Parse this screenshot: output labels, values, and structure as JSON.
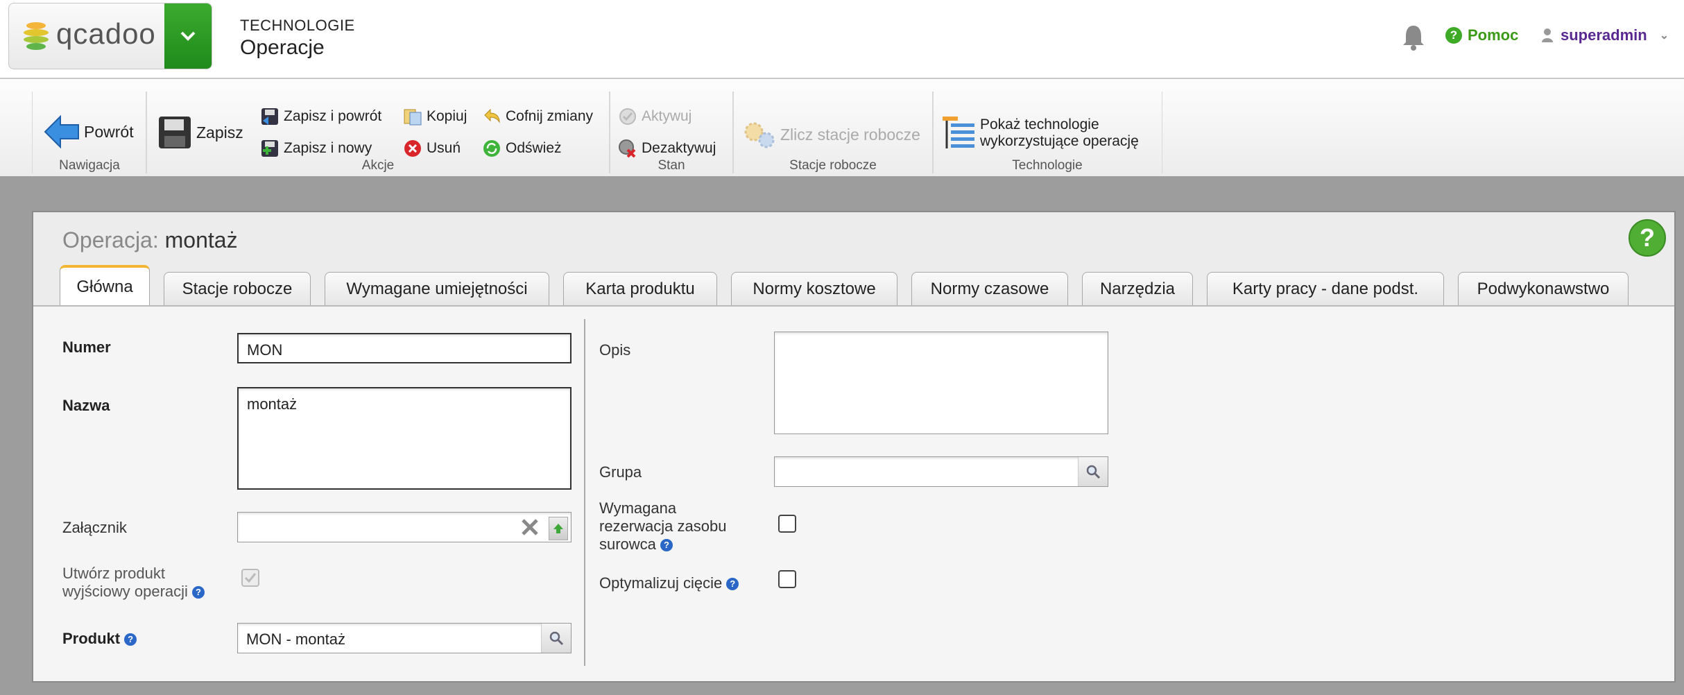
{
  "header": {
    "logo_text": "qcadoo",
    "category": "TECHNOLOGIE",
    "title": "Operacje",
    "help_label": "Pomoc",
    "user": "superadmin"
  },
  "ribbon": {
    "groups": {
      "nav": "Nawigacja",
      "actions": "Akcje",
      "state": "Stan",
      "workstations": "Stacje robocze",
      "technologies": "Technologie"
    },
    "back": "Powrót",
    "save": "Zapisz",
    "save_back": "Zapisz i powrót",
    "save_new": "Zapisz i nowy",
    "copy": "Kopiuj",
    "delete": "Usuń",
    "undo": "Cofnij zmiany",
    "refresh": "Odśwież",
    "activate": "Aktywuj",
    "deactivate": "Dezaktywuj",
    "count_workstations": "Zlicz stacje robocze",
    "show_tech_line1": "Pokaż technologie",
    "show_tech_line2": "wykorzystujące operację"
  },
  "form": {
    "title_prefix": "Operacja:",
    "title_value": "montaż",
    "tabs": [
      "Główna",
      "Stacje robocze",
      "Wymagane umiejętności",
      "Karta produktu",
      "Normy kosztowe",
      "Normy czasowe",
      "Narzędzia",
      "Karty pracy - dane podst.",
      "Podwykonawstwo"
    ],
    "fields": {
      "number_label": "Numer",
      "number_value": "MON",
      "name_label": "Nazwa",
      "name_value": "montaż",
      "attachment_label": "Załącznik",
      "create_output_label_1": "Utwórz produkt",
      "create_output_label_2": "wyjściowy operacji",
      "create_output_checked": true,
      "product_label": "Produkt",
      "product_value": "MON - montaż",
      "description_label": "Opis",
      "group_label": "Grupa",
      "reservation_label_1": "Wymagana",
      "reservation_label_2": "rezerwacja zasobu",
      "reservation_label_3": "surowca",
      "optimize_label": "Optymalizuj cięcie"
    }
  },
  "colors": {
    "accent_green": "#3eaa26",
    "user_purple": "#5a2891",
    "active_tab_border": "#f2b632",
    "info_blue": "#2a67c7"
  }
}
